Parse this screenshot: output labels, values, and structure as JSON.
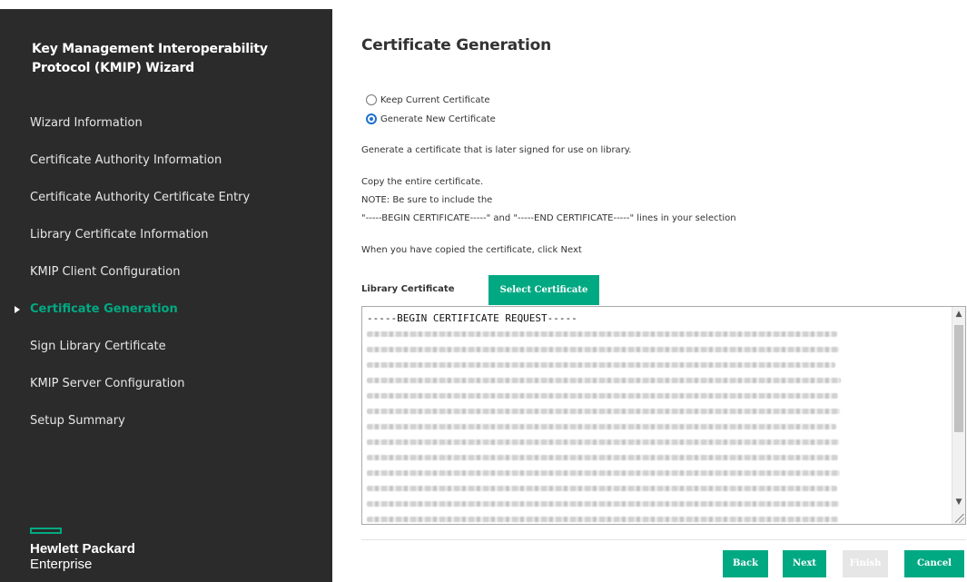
{
  "sidebar": {
    "title": "Key Management Interoperability Protocol (KMIP) Wizard",
    "items": [
      {
        "label": "Wizard Information"
      },
      {
        "label": "Certificate Authority Information"
      },
      {
        "label": "Certificate Authority Certificate Entry"
      },
      {
        "label": "Library Certificate Information"
      },
      {
        "label": "KMIP Client Configuration"
      },
      {
        "label": "Certificate Generation",
        "active": true
      },
      {
        "label": "Sign Library Certificate"
      },
      {
        "label": "KMIP Server Configuration"
      },
      {
        "label": "Setup Summary"
      }
    ],
    "logo": {
      "line1": "Hewlett Packard",
      "line2": "Enterprise"
    }
  },
  "main": {
    "title": "Certificate Generation",
    "radios": {
      "keep": {
        "label": "Keep Current Certificate",
        "checked": false
      },
      "generate": {
        "label": "Generate New Certificate",
        "checked": true
      }
    },
    "description": "Generate a certificate that is later signed for use on library.",
    "copy_instruction": "Copy the entire certificate.",
    "note": "NOTE: Be sure to include the",
    "note_lines": "\"-----BEGIN CERTIFICATE-----\" and \"-----END CERTIFICATE-----\" lines in your selection",
    "next_instruction": "When you have copied the certificate, click Next",
    "library_certificate_label": "Library Certificate",
    "select_certificate_label": "Select Certificate",
    "certificate_first_line": "-----BEGIN CERTIFICATE REQUEST-----",
    "buttons": {
      "back": "Back",
      "next": "Next",
      "finish": "Finish",
      "cancel": "Cancel"
    }
  },
  "colors": {
    "accent": "#01a982",
    "sidebar_bg": "#2b2b2b",
    "radio_checked": "#1d6fd0"
  },
  "icons": {
    "active_marker": "caret-right-icon",
    "scroll_up": "chevron-up-icon",
    "scroll_down": "chevron-down-icon"
  }
}
